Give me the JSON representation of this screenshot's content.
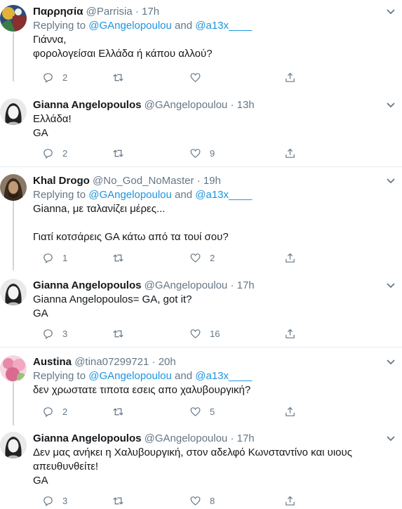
{
  "tweets": [
    {
      "name": "Παρρησία",
      "handle": "@Parrisia",
      "dot": "·",
      "time": "17h",
      "replying_prefix": "Replying to ",
      "replying_to_1": "@GAngelopoulou",
      "replying_and": " and ",
      "replying_to_2": "@a13x____",
      "text": "Γιάννα,\nφορολογείσαι Ελλάδα ή κάπου αλλού?",
      "replies": "2",
      "retweets": "",
      "likes": ""
    },
    {
      "name": "Gianna Angelopoulos",
      "handle": "@GAngelopoulou",
      "dot": "·",
      "time": "13h",
      "text": "Ελλάδα!\nGA",
      "replies": "2",
      "retweets": "",
      "likes": "9"
    },
    {
      "name": "Khal Drogo",
      "handle": "@No_God_NoMaster",
      "dot": "·",
      "time": "19h",
      "replying_prefix": "Replying to ",
      "replying_to_1": "@GAngelopoulou",
      "replying_and": " and ",
      "replying_to_2": "@a13x____",
      "text": "Gianna, με ταλανίζει μέρες...\n\nΓιατί κοτσάρεις GA κάτω από τα τουί σου?",
      "replies": "1",
      "retweets": "",
      "likes": "2"
    },
    {
      "name": "Gianna Angelopoulos",
      "handle": "@GAngelopoulou",
      "dot": "·",
      "time": "17h",
      "text": "Gianna Angelopoulos= GA, got it?\nGA",
      "replies": "3",
      "retweets": "",
      "likes": "16"
    },
    {
      "name": "Austina",
      "handle": "@tina07299721",
      "dot": "·",
      "time": "20h",
      "replying_prefix": "Replying to ",
      "replying_to_1": "@GAngelopoulou",
      "replying_and": " and ",
      "replying_to_2": "@a13x____",
      "text": "δεν χρωστατε τιποτα εσεις απο χαλυβουργική?",
      "replies": "2",
      "retweets": "",
      "likes": "5"
    },
    {
      "name": "Gianna Angelopoulos",
      "handle": "@GAngelopoulou",
      "dot": "·",
      "time": "17h",
      "text": "Δεν μας ανήκει η Χαλυβουργική, στον αδελφό Κωνσταντίνο και υιους\nαπευθυνθείτε!\nGA",
      "replies": "3",
      "retweets": "",
      "likes": "8"
    }
  ],
  "icons": {
    "reply": "reply-icon",
    "retweet": "retweet-icon",
    "like": "heart-icon",
    "share": "share-icon",
    "more": "chevron-down-icon"
  },
  "colors": {
    "link": "#1b95e0",
    "muted": "#657786",
    "thread_line": "#ccd6dd",
    "separator": "#e6ecf0"
  }
}
